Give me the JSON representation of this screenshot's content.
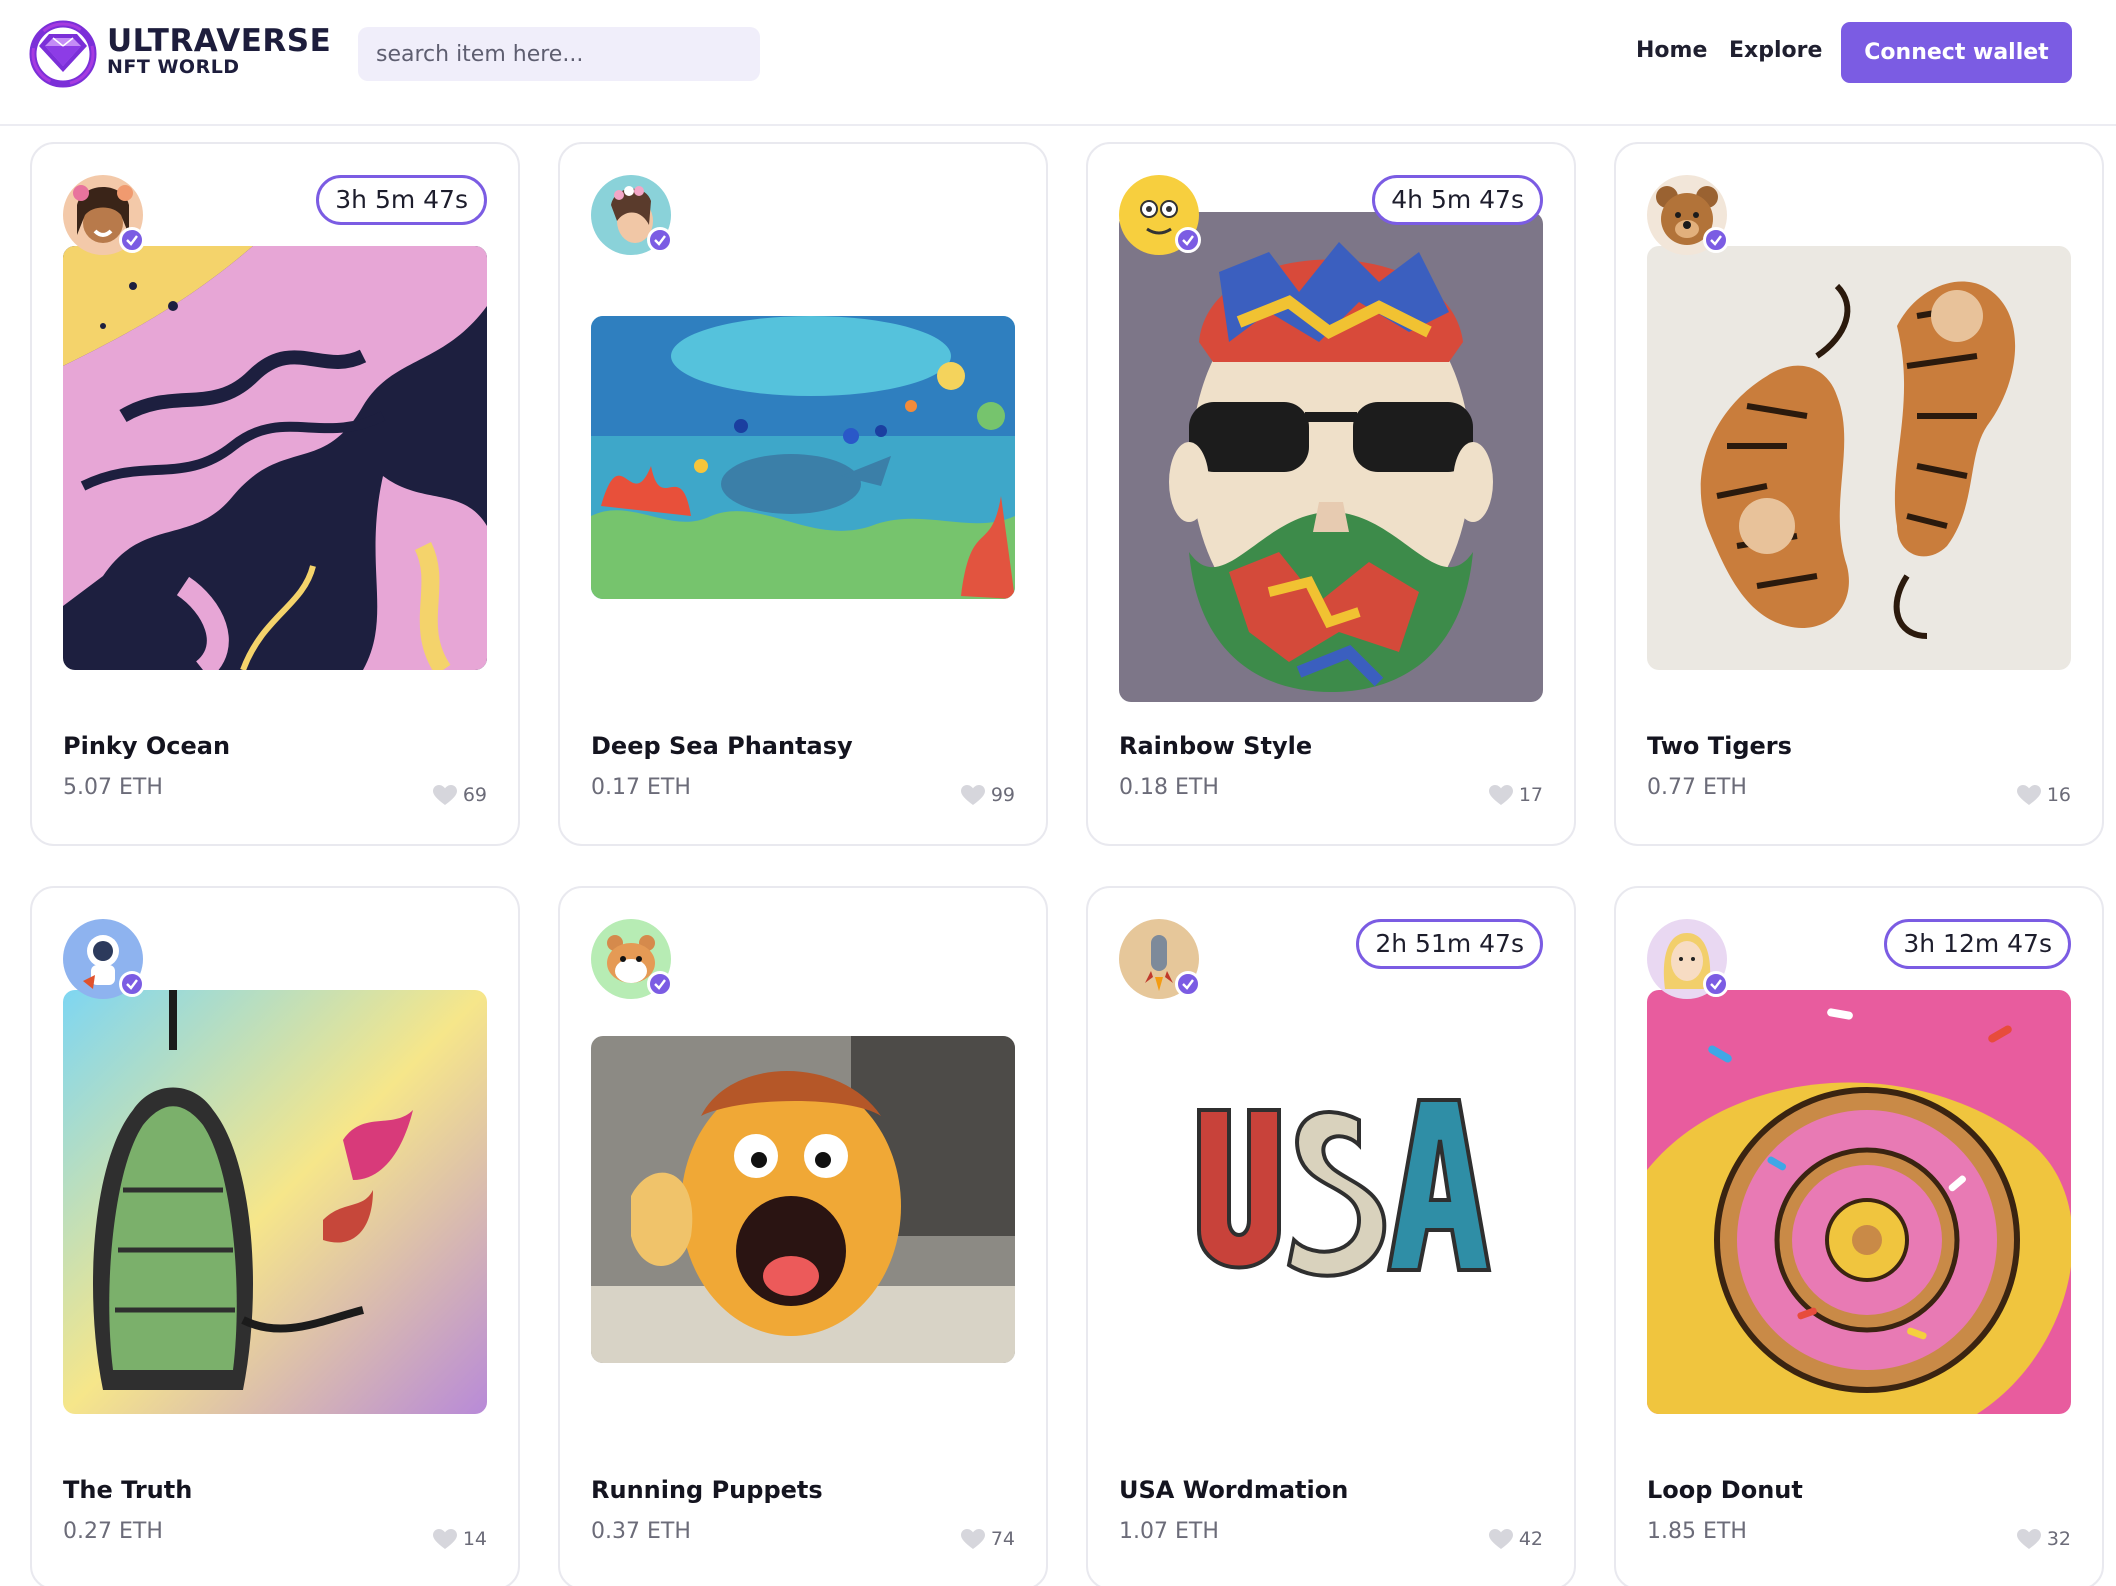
{
  "brand": {
    "line1": "ULTRAVERSE",
    "line2": "NFT WORLD",
    "accent": "#7b5ce3"
  },
  "search": {
    "placeholder": "search item here..."
  },
  "nav": {
    "home": "Home",
    "explore": "Explore",
    "connect": "Connect wallet"
  },
  "cards": [
    {
      "title": "Pinky Ocean",
      "price": "5.07 ETH",
      "likes": "69",
      "timer": "3h 5m 47s",
      "verified": true
    },
    {
      "title": "Deep Sea Phantasy",
      "price": "0.17 ETH",
      "likes": "99",
      "timer": "",
      "verified": true
    },
    {
      "title": "Rainbow Style",
      "price": "0.18 ETH",
      "likes": "17",
      "timer": "4h 5m 47s",
      "verified": true
    },
    {
      "title": "Two Tigers",
      "price": "0.77 ETH",
      "likes": "16",
      "timer": "",
      "verified": true
    },
    {
      "title": "The Truth",
      "price": "0.27 ETH",
      "likes": "14",
      "timer": "",
      "verified": true
    },
    {
      "title": "Running Puppets",
      "price": "0.37 ETH",
      "likes": "74",
      "timer": "",
      "verified": true
    },
    {
      "title": "USA Wordmation",
      "price": "1.07 ETH",
      "likes": "42",
      "timer": "2h 51m 47s",
      "verified": true
    },
    {
      "title": "Loop Donut",
      "price": "1.85 ETH",
      "likes": "32",
      "timer": "3h 12m 47s",
      "verified": true
    }
  ]
}
